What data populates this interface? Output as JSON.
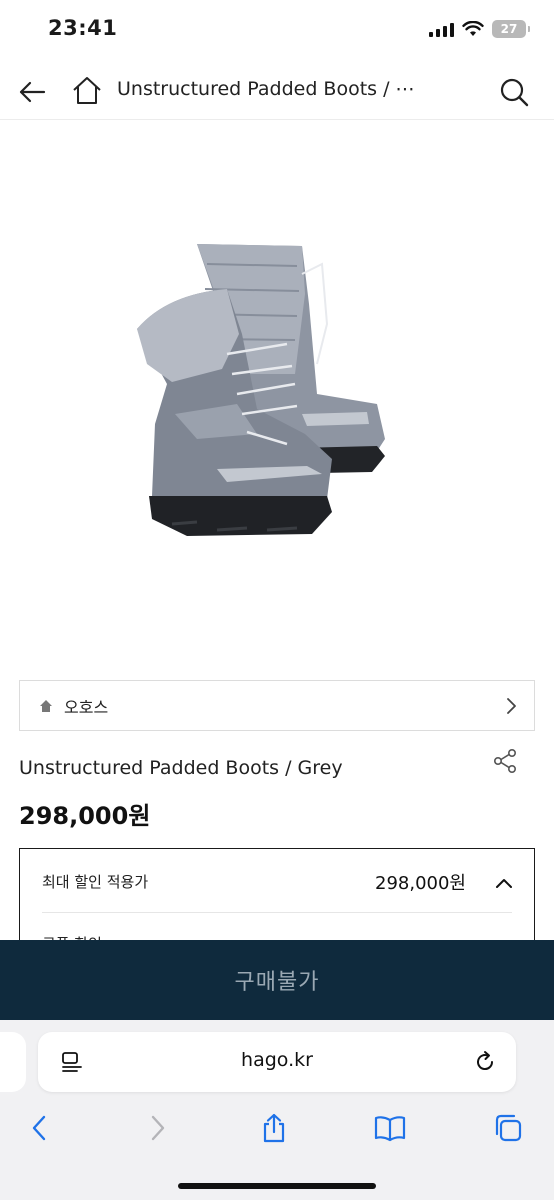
{
  "status_bar": {
    "time": "23:41",
    "battery": "27"
  },
  "nav": {
    "title": "Unstructured Padded Boots / ⋯"
  },
  "product": {
    "brand": "오호스",
    "name": "Unstructured Padded Boots / Grey",
    "price": "298,000원"
  },
  "discount": {
    "label": "최대 할인 적용가",
    "price": "298,000원",
    "coupon_label": "쿠폰 할인"
  },
  "buy": {
    "label": "구매불가"
  },
  "browser": {
    "url": "hago.kr"
  },
  "colors": {
    "accent": "#0f2a3d",
    "safari_blue": "#1f72e8"
  }
}
